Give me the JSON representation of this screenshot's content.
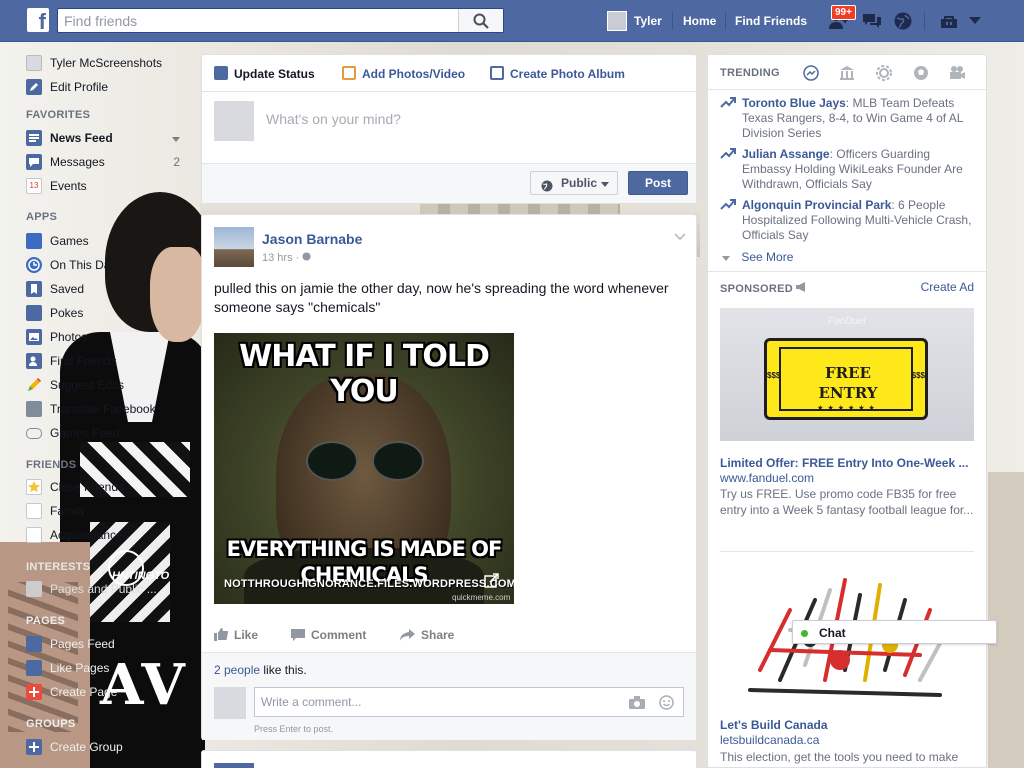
{
  "topbar": {
    "logo_letter": "f",
    "search_placeholder": "Find friends",
    "user_name": "Tyler",
    "home_label": "Home",
    "find_friends_label": "Find Friends",
    "friend_requests_badge": "99+",
    "brand_color": "#4e69a2"
  },
  "sidebar": {
    "profile_name": "Tyler McScreenshots",
    "edit_profile": "Edit Profile",
    "favorites_header": "FAVORITES",
    "favorites": [
      {
        "label": "News Feed",
        "icon": "news-feed-icon"
      },
      {
        "label": "Messages",
        "count": "2",
        "icon": "messages-icon"
      },
      {
        "label": "Events",
        "icon": "calendar-icon",
        "icon_text": "13"
      }
    ],
    "apps_header": "APPS",
    "apps": [
      {
        "label": "Games",
        "icon": "games-icon"
      },
      {
        "label": "On This Day",
        "icon": "clock-icon"
      },
      {
        "label": "Saved",
        "icon": "bookmark-icon"
      },
      {
        "label": "Pokes",
        "icon": "poke-icon"
      },
      {
        "label": "Photos",
        "icon": "photos-icon"
      },
      {
        "label": "Find Friends",
        "icon": "find-friends-icon"
      },
      {
        "label": "Suggest Edits",
        "icon": "pencil-icon"
      },
      {
        "label": "Translate Facebook",
        "icon": "translate-icon"
      },
      {
        "label": "Games Feed",
        "icon": "gamepad-icon"
      }
    ],
    "friends_header": "FRIENDS",
    "friends": [
      {
        "label": "Close Friends",
        "icon": "star-icon"
      },
      {
        "label": "Family",
        "icon": "family-icon"
      },
      {
        "label": "Acquaintances",
        "icon": "acquaintances-icon"
      }
    ],
    "interests_header": "INTERESTS",
    "interests": [
      {
        "label": "Pages and Public ...",
        "icon": "list-icon"
      }
    ],
    "pages_header": "PAGES",
    "pages": [
      {
        "label": "Pages Feed",
        "icon": "flag-icon"
      },
      {
        "label": "Like Pages",
        "icon": "thumbs-up-icon"
      },
      {
        "label": "Create Page",
        "icon": "plus-icon"
      }
    ],
    "groups_header": "GROUPS",
    "groups": [
      {
        "label": "Create Group",
        "icon": "plus-icon"
      }
    ],
    "wallpaper_text_1": "HNTINGTO",
    "wallpaper_text_2": "AV"
  },
  "composer": {
    "tab_update": "Update Status",
    "tab_photos": "Add Photos/Video",
    "tab_album": "Create Photo Album",
    "placeholder": "What's on your mind?",
    "audience": "Public",
    "post_label": "Post"
  },
  "story": {
    "author": "Jason Barnabe",
    "time": "13 hrs",
    "text": "pulled this on jamie the other day, now he's spreading the word whenever someone says \"chemicals\"",
    "meme_top": "WHAT IF I TOLD YOU",
    "meme_bottom": "EVERYTHING IS MADE OF CHEMICALS",
    "source": "NOTTHROUGHIGNORANCE.FILES.WORDPRESS.COM",
    "watermark": "quickmeme.com",
    "like_label": "Like",
    "comment_label": "Comment",
    "share_label": "Share",
    "likes_count": "2 people",
    "likes_suffix": " like this.",
    "comment_placeholder": "Write a comment...",
    "comment_hint": "Press Enter to post."
  },
  "trending": {
    "header": "TRENDING",
    "items": [
      {
        "name": "Toronto Blue Jays",
        "desc": ": MLB Team Defeats Texas Rangers, 8-4, to Win Game 4 of AL Division Series"
      },
      {
        "name": "Julian Assange",
        "desc": ": Officers Guarding Embassy Holding WikiLeaks Founder Are Withdrawn, Officials Say"
      },
      {
        "name": "Algonquin Provincial Park",
        "desc": ": 6 People Hospitalized Following Multi-Vehicle Crash, Officials Say"
      }
    ],
    "see_more": "See More"
  },
  "sponsored": {
    "header": "SPONSORED",
    "create_ad": "Create Ad",
    "ad1": {
      "brand": "FanDuel",
      "ticket_line1": "FREE",
      "ticket_line2": "ENTRY",
      "ticket_side": "$$$",
      "title": "Limited Offer: FREE Entry Into One-Week ...",
      "url": "www.fanduel.com",
      "desc": "Try us FREE. Use promo code FB35 for free entry into a Week 5 fantasy football league for..."
    },
    "ad2": {
      "title": "Let's Build Canada",
      "url": "letsbuildcanada.ca",
      "desc": "This election, get the tools you need to make"
    }
  },
  "chat": {
    "label": "Chat",
    "status_color": "#42b72a"
  }
}
